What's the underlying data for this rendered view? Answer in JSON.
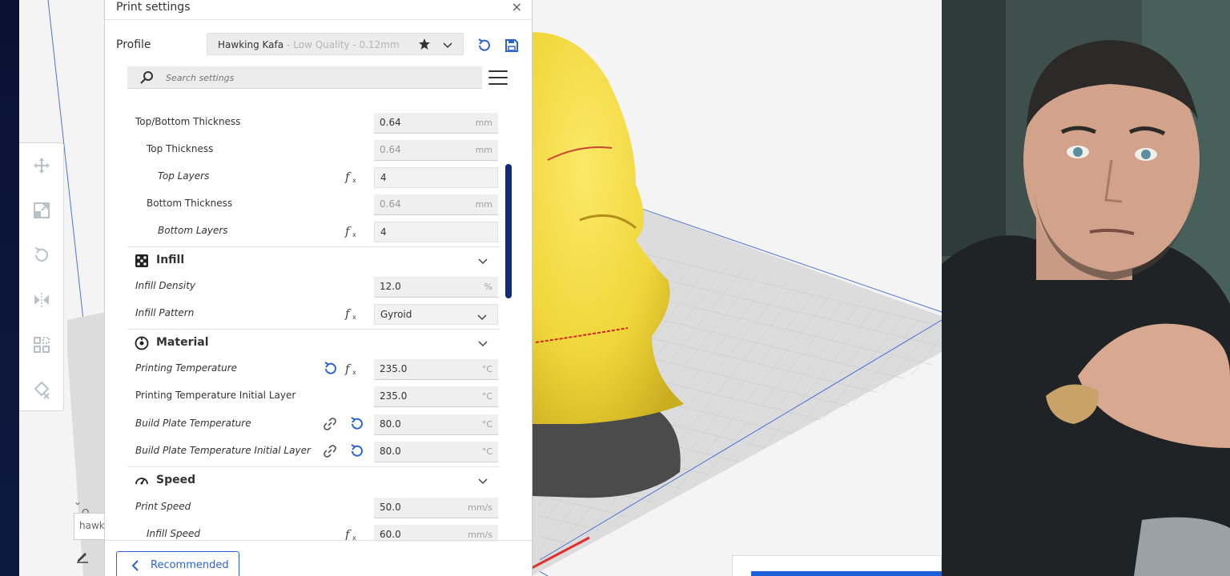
{
  "panel": {
    "title": "Print settings",
    "close_label": "×",
    "profile_label": "Profile",
    "profile_name": "Hawking Kafa",
    "profile_quality": "- Low Quality - 0.12mm",
    "search_placeholder": "Search settings"
  },
  "settings": {
    "top_bottom_thickness": {
      "label": "Top/Bottom Thickness",
      "value": "0.64",
      "unit": "mm"
    },
    "top_thickness": {
      "label": "Top Thickness",
      "value": "0.64",
      "unit": "mm"
    },
    "top_layers": {
      "label": "Top Layers",
      "value": "4"
    },
    "bottom_thickness": {
      "label": "Bottom Thickness",
      "value": "0.64",
      "unit": "mm"
    },
    "bottom_layers": {
      "label": "Bottom Layers",
      "value": "4"
    },
    "infill": {
      "label": "Infill"
    },
    "infill_density": {
      "label": "Infill Density",
      "value": "12.0",
      "unit": "%"
    },
    "infill_pattern": {
      "label": "Infill Pattern",
      "value": "Gyroid"
    },
    "material": {
      "label": "Material"
    },
    "printing_temperature": {
      "label": "Printing Temperature",
      "value": "235.0",
      "unit": "°C"
    },
    "printing_temperature_initial": {
      "label": "Printing Temperature Initial Layer",
      "value": "235.0",
      "unit": "°C"
    },
    "build_plate_temperature": {
      "label": "Build Plate Temperature",
      "value": "80.0",
      "unit": "°C"
    },
    "build_plate_temperature_initial": {
      "label": "Build Plate Temperature Initial Layer",
      "value": "80.0",
      "unit": "°C"
    },
    "speed": {
      "label": "Speed"
    },
    "print_speed": {
      "label": "Print Speed",
      "value": "50.0",
      "unit": "mm/s"
    },
    "infill_speed": {
      "label": "Infill Speed",
      "value": "60.0",
      "unit": "mm/s"
    }
  },
  "footer": {
    "recommended_label": "Recommended"
  },
  "object_list": {
    "toggle_label": "O",
    "field_value": "hawk"
  },
  "colors": {
    "accent": "#2a62d6",
    "model": "#f2dc3c",
    "scrollbar": "#122a7a"
  }
}
